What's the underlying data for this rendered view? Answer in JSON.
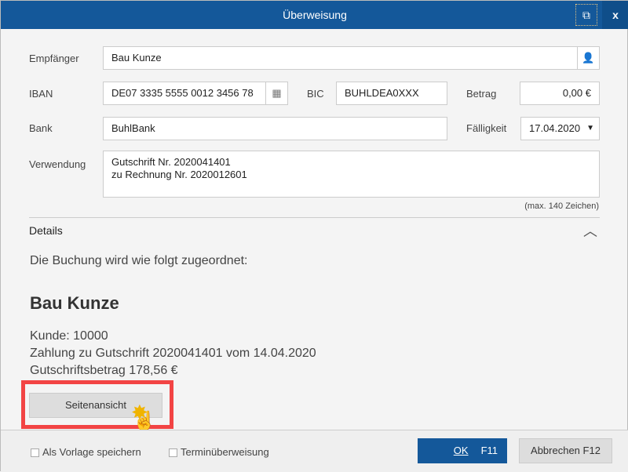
{
  "window": {
    "title": "Überweisung",
    "popout_icon": "external-link-icon",
    "close_label": "x"
  },
  "form": {
    "recipient_label": "Empfänger",
    "recipient_value": "Bau Kunze",
    "iban_label": "IBAN",
    "iban_value": "DE07 3335 5555 0012 3456 78",
    "bic_label": "BIC",
    "bic_value": "BUHLDEA0XXX",
    "amount_label": "Betrag",
    "amount_value": "0,00 €",
    "bank_label": "Bank",
    "bank_value": "BuhlBank",
    "due_label": "Fälligkeit",
    "due_value": "17.04.2020",
    "purpose_label": "Verwendung",
    "purpose_line1": "Gutschrift Nr. 2020041401",
    "purpose_line2": "zu Rechnung Nr. 2020012601",
    "purpose_hint": "(max. 140 Zeichen)"
  },
  "details": {
    "header": "Details",
    "intro": "Die Buchung wird wie folgt zugeordnet:",
    "name": "Bau Kunze",
    "line1": "Kunde: 10000",
    "line2": "Zahlung zu Gutschrift 2020041401 vom 14.04.2020",
    "line3": "Gutschriftsbetrag 178,56 €",
    "preview_button": "Seitenansicht"
  },
  "footer": {
    "save_template": "Als Vorlage speichern",
    "scheduled": "Terminüberweisung",
    "ok": "OK",
    "ok_key": "F11",
    "cancel": "Abbrechen",
    "cancel_key": "F12"
  },
  "colors": {
    "accent": "#14589a",
    "highlight": "#f24444"
  }
}
